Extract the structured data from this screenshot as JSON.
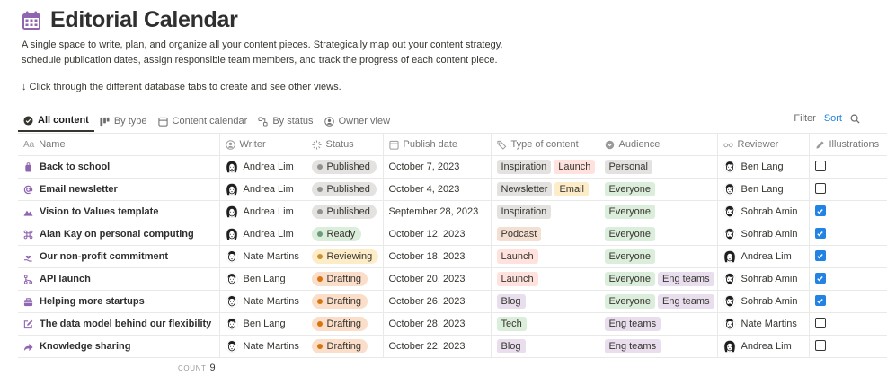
{
  "page": {
    "title": "Editorial Calendar",
    "description": "A single space to write, plan, and organize all your content pieces. Strategically map out your content strategy, schedule publication dates, assign responsible team members, and track the progress of each content piece.",
    "hint": "↓ Click through the different database tabs to create and see other views."
  },
  "tabs": [
    {
      "label": "All content",
      "icon": "check-circle-icon"
    },
    {
      "label": "By type",
      "icon": "columns-icon"
    },
    {
      "label": "Content calendar",
      "icon": "calendar-icon"
    },
    {
      "label": "By status",
      "icon": "status-icon"
    },
    {
      "label": "Owner view",
      "icon": "person-icon"
    }
  ],
  "toolbar": {
    "filter": "Filter",
    "sort": "Sort"
  },
  "columns": {
    "name": "Name",
    "writer": "Writer",
    "status": "Status",
    "publish_date": "Publish date",
    "type": "Type of content",
    "audience": "Audience",
    "reviewer": "Reviewer",
    "illustrations": "Illustrations"
  },
  "colors": {
    "accent": "#2383e2",
    "icon_purple": "#9065b0",
    "status": {
      "Published": {
        "bg": "#e3e2e0",
        "dot": "#91918e"
      },
      "Ready": {
        "bg": "#dbeddb",
        "dot": "#6c9b7d"
      },
      "Reviewing": {
        "bg": "#fdecc8",
        "dot": "#cb912f"
      },
      "Drafting": {
        "bg": "#fadec9",
        "dot": "#d9730d"
      }
    },
    "tags": {
      "Inspiration": "#e3e2e0",
      "Launch": "#ffe2dd",
      "Newsletter": "#e3e2e0",
      "Email": "#fdecc8",
      "Podcast": "#f4dfd3",
      "Blog": "#e8deee",
      "Tech": "#dbeddb",
      "Personal": "#e3e2e0",
      "Everyone": "#dbeddb",
      "Eng teams": "#e8deee"
    }
  },
  "rows": [
    {
      "name": "Back to school",
      "icon": "backpack-icon",
      "writer": "Andrea Lim",
      "status": "Published",
      "date": "October 7, 2023",
      "types": [
        "Inspiration",
        "Launch"
      ],
      "audience": [
        "Personal"
      ],
      "reviewer": "Ben Lang",
      "illustrations": false
    },
    {
      "name": "Email newsletter",
      "icon": "at-sign-icon",
      "writer": "Andrea Lim",
      "status": "Published",
      "date": "October 4, 2023",
      "types": [
        "Newsletter",
        "Email"
      ],
      "audience": [
        "Everyone"
      ],
      "reviewer": "Ben Lang",
      "illustrations": false
    },
    {
      "name": "Vision to Values template",
      "icon": "mountain-icon",
      "writer": "Andrea Lim",
      "status": "Published",
      "date": "September 28, 2023",
      "types": [
        "Inspiration"
      ],
      "audience": [
        "Everyone"
      ],
      "reviewer": "Sohrab Amin",
      "illustrations": true
    },
    {
      "name": "Alan Kay on personal computing",
      "icon": "command-icon",
      "writer": "Andrea Lim",
      "status": "Ready",
      "date": "October 12, 2023",
      "types": [
        "Podcast"
      ],
      "audience": [
        "Everyone"
      ],
      "reviewer": "Sohrab Amin",
      "illustrations": true
    },
    {
      "name": "Our non-profit commitment",
      "icon": "hand-heart-icon",
      "writer": "Nate Martins",
      "status": "Reviewing",
      "date": "October 18, 2023",
      "types": [
        "Launch"
      ],
      "audience": [
        "Everyone"
      ],
      "reviewer": "Andrea Lim",
      "illustrations": true
    },
    {
      "name": "API launch",
      "icon": "branch-icon",
      "writer": "Ben Lang",
      "status": "Drafting",
      "date": "October 20, 2023",
      "types": [
        "Launch"
      ],
      "audience": [
        "Everyone",
        "Eng teams"
      ],
      "reviewer": "Sohrab Amin",
      "illustrations": true
    },
    {
      "name": "Helping more startups",
      "icon": "briefcase-icon",
      "writer": "Nate Martins",
      "status": "Drafting",
      "date": "October 26, 2023",
      "types": [
        "Blog"
      ],
      "audience": [
        "Everyone",
        "Eng teams"
      ],
      "reviewer": "Sohrab Amin",
      "illustrations": true
    },
    {
      "name": "The data model behind our flexibility",
      "icon": "edit-icon",
      "writer": "Ben Lang",
      "status": "Drafting",
      "date": "October 28, 2023",
      "types": [
        "Tech"
      ],
      "audience": [
        "Eng teams"
      ],
      "reviewer": "Nate Martins",
      "illustrations": false
    },
    {
      "name": "Knowledge sharing",
      "icon": "share-arrow-icon",
      "writer": "Nate Martins",
      "status": "Drafting",
      "date": "October 22, 2023",
      "types": [
        "Blog"
      ],
      "audience": [
        "Eng teams"
      ],
      "reviewer": "Andrea Lim",
      "illustrations": false
    }
  ],
  "footer": {
    "count_label": "COUNT",
    "count_value": "9"
  }
}
